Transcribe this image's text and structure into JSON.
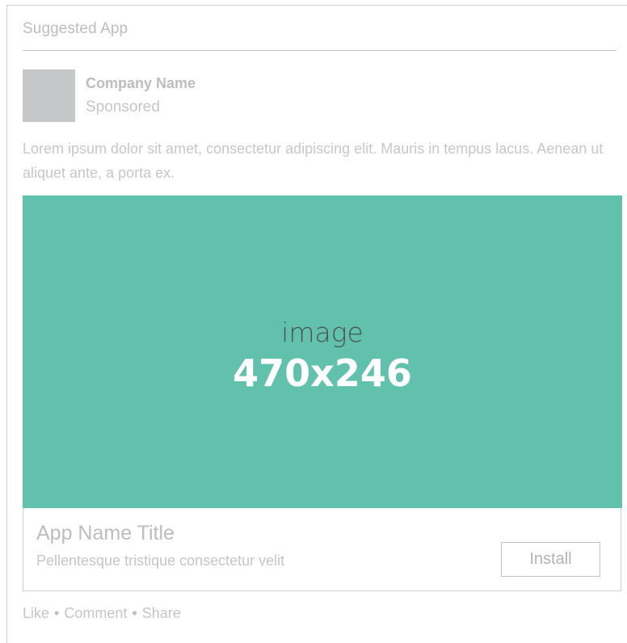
{
  "header": {
    "title": "Suggested App"
  },
  "post": {
    "company_name": "Company Name",
    "sponsored_label": "Sponsored",
    "body": "Lorem ipsum dolor sit amet, consectetur adipiscing elit. Mauris in tempus lacus. Aenean ut aliquet ante, a porta ex."
  },
  "ad": {
    "image_label": "image",
    "image_size": "470x246",
    "app_title": "App Name Title",
    "app_description": "Pellentesque tristique consectetur velit",
    "install_label": "Install"
  },
  "actions": {
    "like": "Like",
    "comment": "Comment",
    "share": "Share",
    "separator": "•"
  },
  "colors": {
    "image_placeholder": "#62c1ad",
    "avatar_placeholder": "#c6c7c9",
    "muted_text": "#c6c6c6"
  }
}
